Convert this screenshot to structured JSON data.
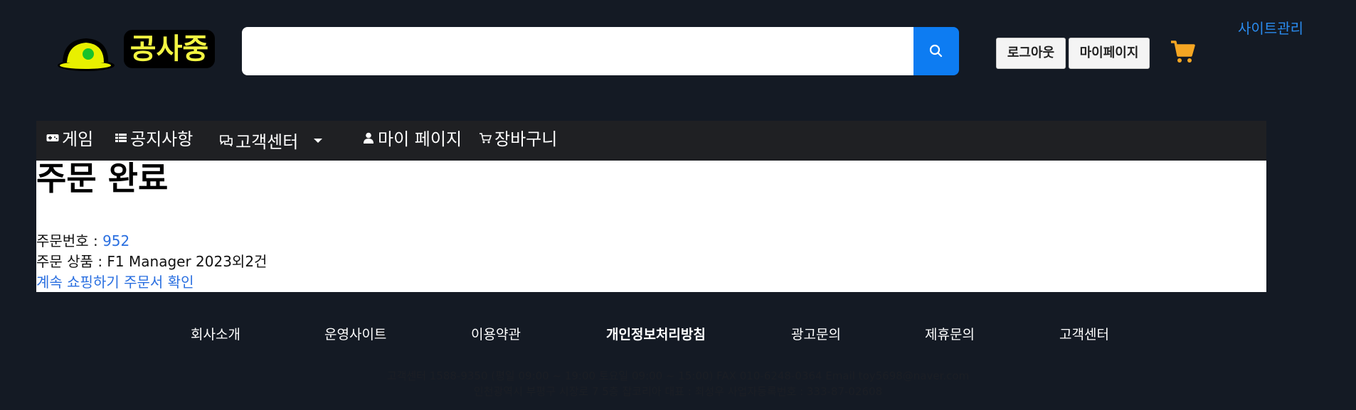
{
  "header": {
    "logo_text": "공사중",
    "search_placeholder": "",
    "logout_label": "로그아웃",
    "mypage_label": "마이페이지",
    "site_admin_label": "사이트관리",
    "accent_color": "#0d7cf2",
    "cart_color": "#f5a623"
  },
  "nav": {
    "items": [
      {
        "label": "게임",
        "icon": "gamepad-icon"
      },
      {
        "label": "공지사항",
        "icon": "list-icon"
      },
      {
        "label": "고객센터",
        "icon": "chat-icon"
      },
      {
        "label": "마이 페이지",
        "icon": "user-icon"
      },
      {
        "label": "장바구니",
        "icon": "cart-icon"
      }
    ]
  },
  "main": {
    "title": "주문 완료",
    "order_number_label": "주문번호 : ",
    "order_number": "952",
    "order_items_label": "주문 상품 : ",
    "order_items": "F1 Manager 2023외2건",
    "continue_shopping": "계속 쇼핑하기",
    "view_order": "주문서 확인"
  },
  "footer": {
    "links": [
      "회사소개",
      "운영사이트",
      "이용약관",
      "개인정보처리방침",
      "광고문의",
      "제휴문의",
      "고객센터"
    ],
    "info_line1": "고객센터 1588-9350 (평일 09:00 ~ 19:00 토요일 09:00 ~ 15:00) FAX 010-6248-0364 Email toy5698@naver.com",
    "info_line2": "인천광역시 부평구 시장로 7 5층 잡코리아 대표 : 최성우 사업자등록번호 : 333-87-02608"
  }
}
